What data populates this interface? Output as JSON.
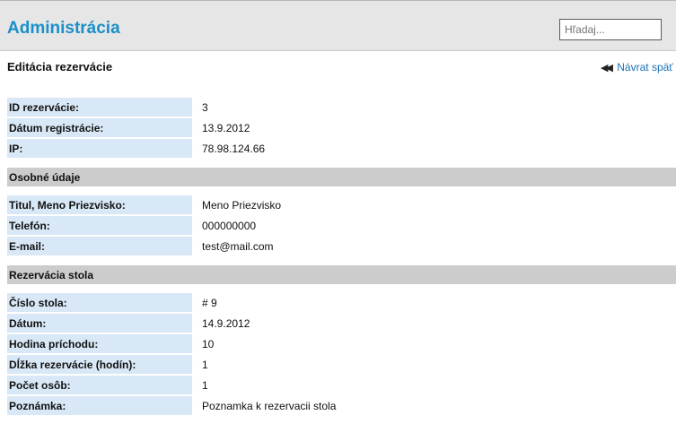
{
  "header": {
    "title": "Administrácia",
    "search_placeholder": "Hľadaj..."
  },
  "page": {
    "title": "Editácia rezervácie",
    "back_label": "Návrat späť"
  },
  "reservation": {
    "rows": [
      {
        "label": "ID rezervácie:",
        "value": "3"
      },
      {
        "label": "Dátum registrácie:",
        "value": "13.9.2012"
      },
      {
        "label": "IP:",
        "value": "78.98.124.66"
      }
    ]
  },
  "personal": {
    "heading": "Osobné údaje",
    "rows": [
      {
        "label": "Titul, Meno Priezvisko:",
        "value": "Meno Priezvisko"
      },
      {
        "label": "Telefón:",
        "value": "000000000"
      },
      {
        "label": "E-mail:",
        "value": "test@mail.com"
      }
    ]
  },
  "table_reservation": {
    "heading": "Rezervácia stola",
    "rows": [
      {
        "label": "Číslo stola:",
        "value": "# 9"
      },
      {
        "label": "Dátum:",
        "value": "14.9.2012"
      },
      {
        "label": "Hodina príchodu:",
        "value": "10"
      },
      {
        "label": "Dĺžka rezervácie (hodín):",
        "value": "1"
      },
      {
        "label": "Počet osôb:",
        "value": "1"
      },
      {
        "label": "Poznámka:",
        "value": "Poznamka k rezervacii stola"
      }
    ]
  }
}
